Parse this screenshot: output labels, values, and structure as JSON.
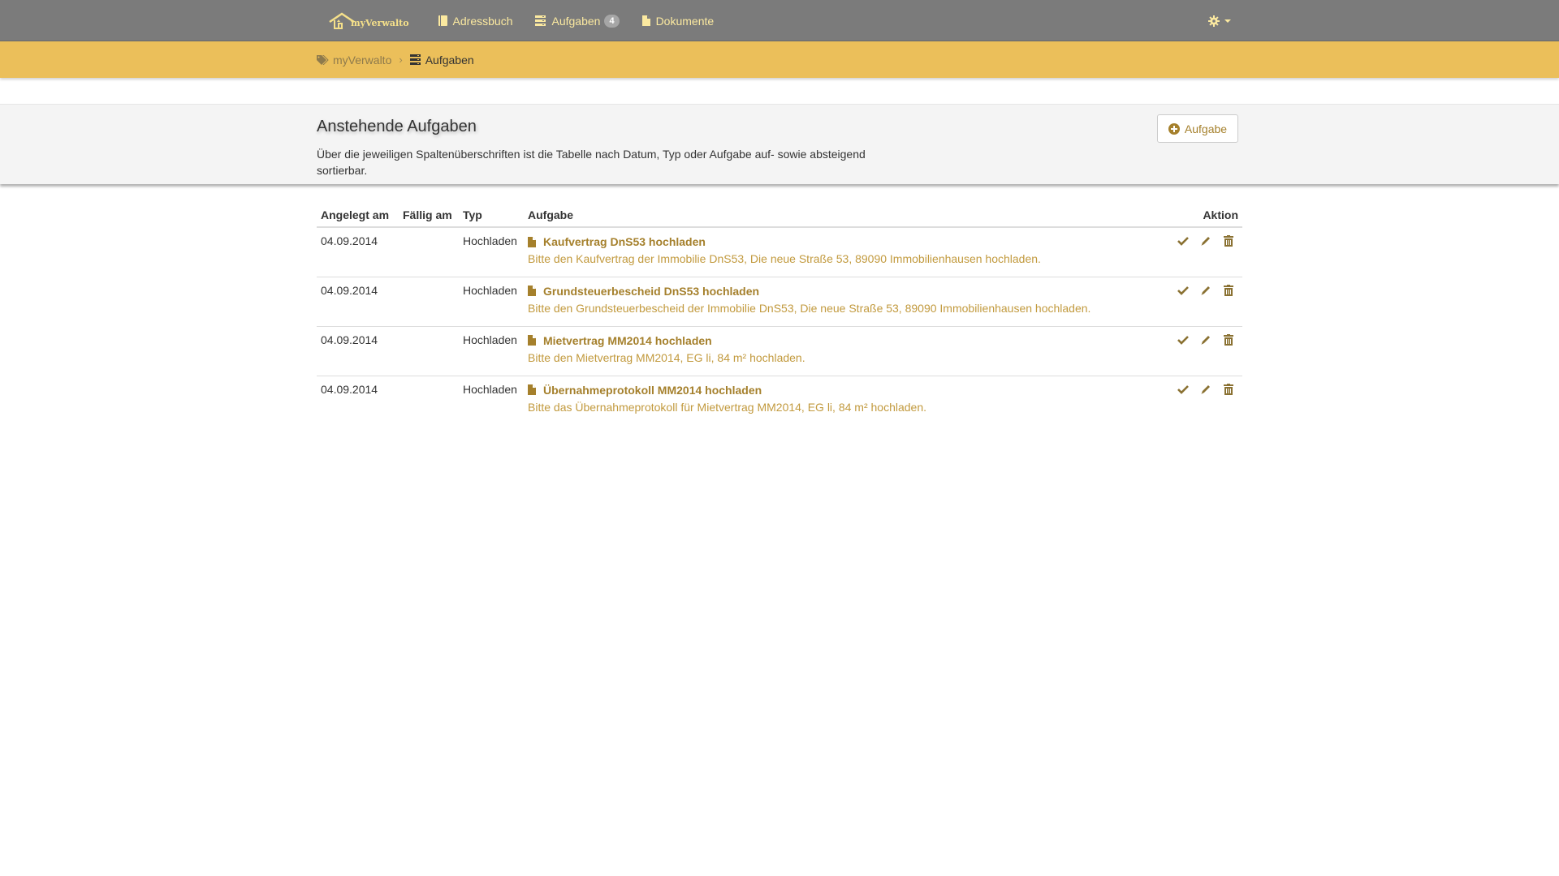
{
  "colors": {
    "navbar": "#7b7b7b",
    "nav_text": "#fbe9a0",
    "crumbbar": "#ebbf5a",
    "accent": "#a5802c",
    "desc_text": "#c29a3e"
  },
  "brand": {
    "text": "myVerwalto",
    "icon": "house-logo-icon"
  },
  "nav": {
    "items": [
      {
        "label": "Adressbuch",
        "icon": "book-icon"
      },
      {
        "label": "Aufgaben",
        "icon": "tasks-icon",
        "badge": "4"
      },
      {
        "label": "Dokumente",
        "icon": "file-icon"
      }
    ],
    "settings_icon": "gear-icon"
  },
  "breadcrumb": {
    "home": "myVerwalto",
    "separator": "›",
    "current": "Aufgaben"
  },
  "header": {
    "title": "Anstehende Aufgaben",
    "description": "Über die jeweiligen Spaltenüberschriften ist die Tabelle nach Datum, Typ oder Aufgabe auf- sowie absteigend sortierbar.",
    "add_button": "Aufgabe"
  },
  "table": {
    "columns": {
      "created": "Angelegt am",
      "due": "Fällig am",
      "type": "Typ",
      "task": "Aufgabe",
      "action": "Aktion"
    },
    "rows": [
      {
        "created": "04.09.2014",
        "due": "",
        "type": "Hochladen",
        "title": "Kaufvertrag DnS53 hochladen",
        "desc": "Bitte den Kaufvertrag der Immobilie DnS53, Die neue Straße 53, 89090 Immobilienhausen hochladen."
      },
      {
        "created": "04.09.2014",
        "due": "",
        "type": "Hochladen",
        "title": "Grundsteuerbescheid DnS53 hochladen",
        "desc": "Bitte den Grundsteuerbescheid der Immobilie DnS53, Die neue Straße 53, 89090 Immobilienhausen hochladen."
      },
      {
        "created": "04.09.2014",
        "due": "",
        "type": "Hochladen",
        "title": "Mietvertrag MM2014 hochladen",
        "desc": "Bitte den Mietvertrag MM2014, EG li, 84 m² hochladen."
      },
      {
        "created": "04.09.2014",
        "due": "",
        "type": "Hochladen",
        "title": "Übernahmeprotokoll MM2014 hochladen",
        "desc": "Bitte das Übernahmeprotokoll für Mietvertrag MM2014, EG li, 84 m² hochladen."
      }
    ]
  }
}
